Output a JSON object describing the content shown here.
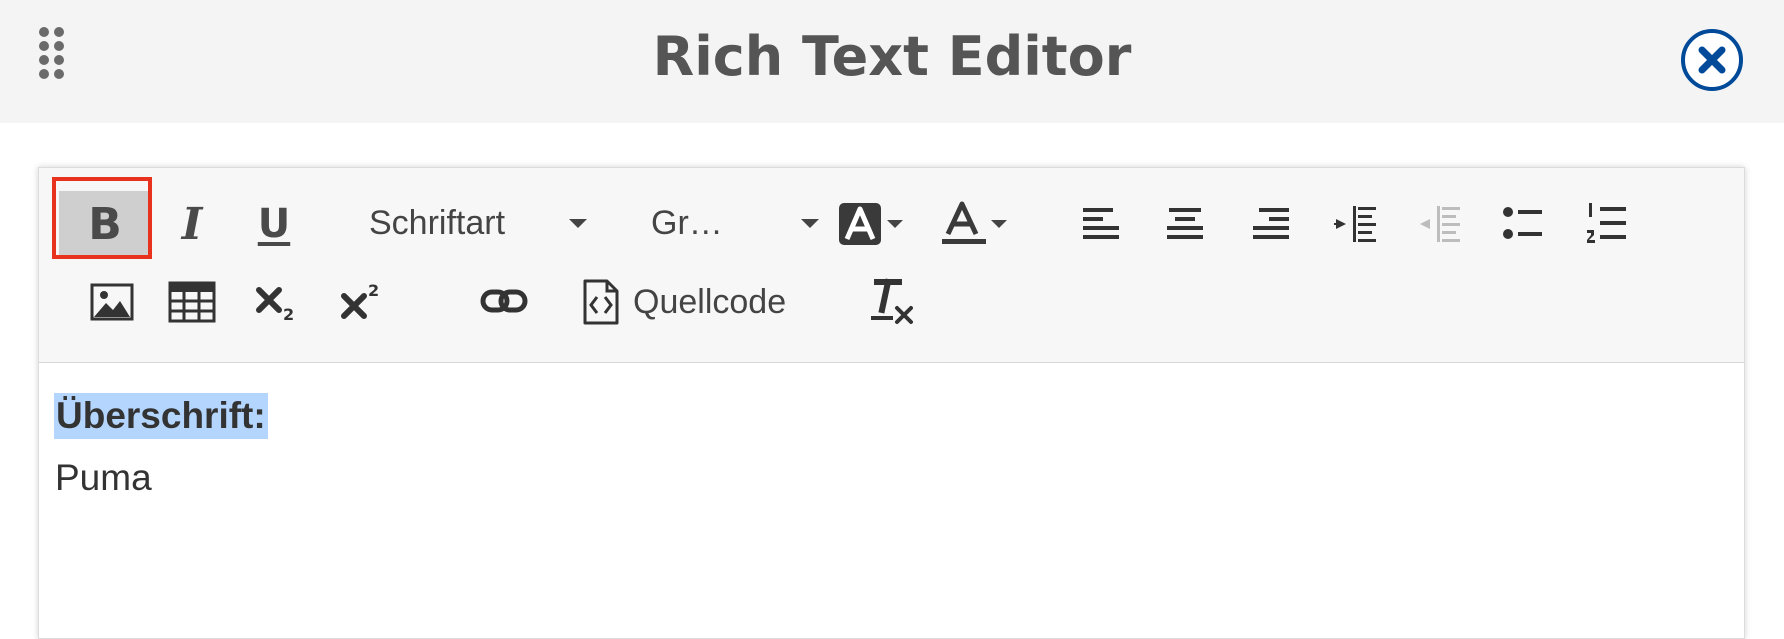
{
  "dialog": {
    "title": "Rich Text Editor",
    "drag_icon": "drag-handle-icon",
    "close_icon": "close-circle-icon",
    "accent_color": "#004a99"
  },
  "toolbar": {
    "bold_label": "B",
    "italic_label": "I",
    "underline_label": "U",
    "font_family": {
      "value": "Schriftart",
      "icon": "chevron-down-icon"
    },
    "font_size": {
      "value": "Gr…",
      "icon": "chevron-down-icon"
    },
    "background_color_icon": "background-color-icon",
    "text_color_icon": "text-color-icon",
    "align_left_icon": "align-left-icon",
    "align_center_icon": "align-center-icon",
    "align_right_icon": "align-right-icon",
    "indent_icon": "indent-icon",
    "outdent_icon": "outdent-icon",
    "bullet_list_icon": "bullet-list-icon",
    "numbered_list_icon": "numbered-list-icon",
    "image_icon": "image-icon",
    "table_icon": "table-icon",
    "subscript_icon": "subscript-icon",
    "superscript_icon": "superscript-icon",
    "link_icon": "link-icon",
    "source_code": {
      "label": "Quellcode",
      "icon": "source-code-icon"
    },
    "clear_format_icon": "clear-formatting-icon",
    "highlight_color": "#e8321e",
    "active_bg": "#cfcfcf"
  },
  "content": {
    "heading": "Überschrift:",
    "body": "Puma",
    "selection_color": "#b4d5fe"
  }
}
